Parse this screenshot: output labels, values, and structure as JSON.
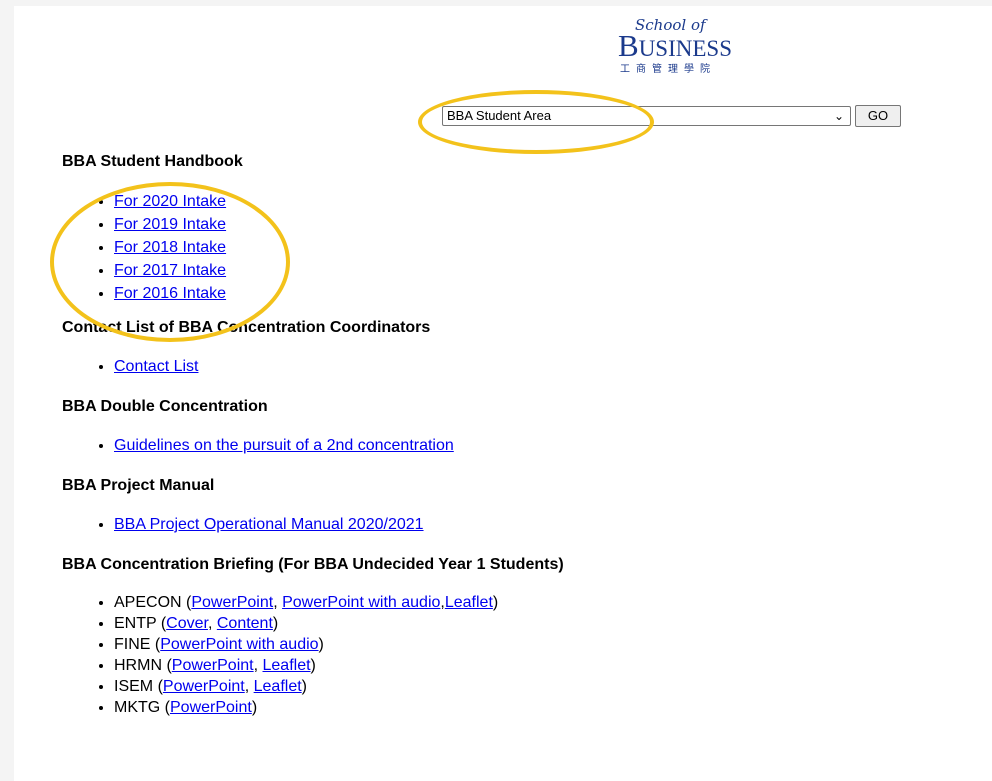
{
  "logo": {
    "school_of": "School of",
    "business_first": "B",
    "business_rest": "USINESS",
    "chinese": "工商管理學院"
  },
  "nav": {
    "selected_area": "BBA Student Area",
    "go_label": "GO"
  },
  "sections": {
    "handbook": {
      "heading": "BBA Student Handbook",
      "links": [
        "For 2020 Intake",
        "For 2019 Intake",
        "For 2018 Intake",
        "For 2017 Intake",
        "For 2016 Intake"
      ]
    },
    "contacts": {
      "heading": "Contact List of BBA Concentration Coordinators",
      "link": "Contact List"
    },
    "double": {
      "heading": "BBA Double Concentration",
      "link": "Guidelines on the pursuit of a 2nd concentration"
    },
    "project": {
      "heading": "BBA Project Manual",
      "link": "BBA Project Operational Manual 2020/2021"
    },
    "briefing": {
      "heading": "BBA Concentration Briefing (For BBA Undecided Year 1 Students)",
      "apecon": {
        "code": "APECON",
        "ppt": "PowerPoint",
        "ppt_audio": "PowerPoint with audio",
        "leaflet": "Leaflet"
      },
      "entp": {
        "code": "ENTP",
        "cover": "Cover",
        "content": "Content"
      },
      "fine": {
        "code": "FINE",
        "ppt_audio": "PowerPoint with audio"
      },
      "hrmn": {
        "code": "HRMN",
        "ppt": "PowerPoint",
        "leaflet": "Leaflet"
      },
      "isem": {
        "code": "ISEM",
        "ppt": "PowerPoint",
        "leaflet": "Leaflet"
      },
      "mktg": {
        "code": "MKTG",
        "ppt": "PowerPoint"
      }
    }
  },
  "colors": {
    "highlight": "#f3c21b",
    "link": "#0000ee",
    "logo": "#1b3a8c"
  }
}
